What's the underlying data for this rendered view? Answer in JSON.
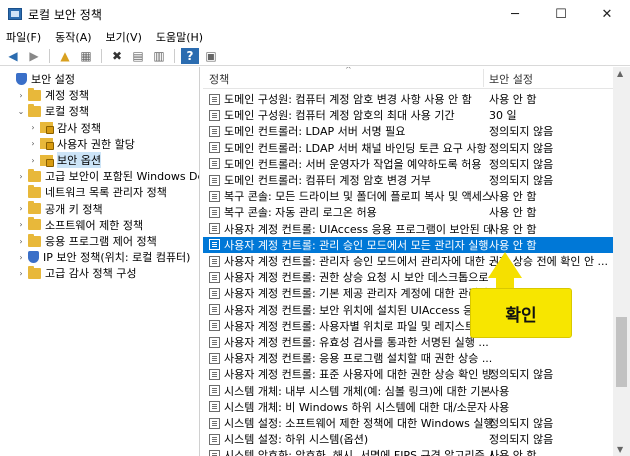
{
  "window": {
    "title": "로컬 보안 정책",
    "minimize": "─",
    "maximize": "☐",
    "close": "✕"
  },
  "menu": [
    "파일(F)",
    "동작(A)",
    "보기(V)",
    "도움말(H)"
  ],
  "toolbar": {
    "back": "◀",
    "forward": "▶",
    "up": "▲",
    "show_hide": "▦",
    "delete": "✖",
    "properties": "▤",
    "export": "▥",
    "help": "?",
    "view": "▣"
  },
  "tree": [
    {
      "label": "보안 설정",
      "level": 0,
      "icon": "shield-icon",
      "expander": ""
    },
    {
      "label": "계정 정책",
      "level": 1,
      "icon": "folder-icon",
      "expander": "›"
    },
    {
      "label": "로컬 정책",
      "level": 1,
      "icon": "folder-icon",
      "expander": "⌄"
    },
    {
      "label": "감사 정책",
      "level": 2,
      "icon": "lock-folder-icon",
      "expander": "›"
    },
    {
      "label": "사용자 권한 할당",
      "level": 2,
      "icon": "lock-folder-icon",
      "expander": "›"
    },
    {
      "label": "보안 옵션",
      "level": 2,
      "icon": "lock-folder-icon",
      "expander": "›",
      "selected": true
    },
    {
      "label": "고급 보안이 포함된 Windows Defende",
      "level": 1,
      "icon": "folder-icon",
      "expander": "›"
    },
    {
      "label": "네트워크 목록 관리자 정책",
      "level": 1,
      "icon": "folder-icon",
      "expander": ""
    },
    {
      "label": "공개 키 정책",
      "level": 1,
      "icon": "folder-icon",
      "expander": "›"
    },
    {
      "label": "소프트웨어 제한 정책",
      "level": 1,
      "icon": "folder-icon",
      "expander": "›"
    },
    {
      "label": "응용 프로그램 제어 정책",
      "level": 1,
      "icon": "folder-icon",
      "expander": "›"
    },
    {
      "label": "IP 보안 정책(위치: 로컬 컴퓨터)",
      "level": 1,
      "icon": "shield-icon",
      "expander": "›"
    },
    {
      "label": "고급 감사 정책 구성",
      "level": 1,
      "icon": "folder-icon",
      "expander": "›"
    }
  ],
  "columns": {
    "policy": "정책",
    "setting": "보안 설정",
    "sort_indicator": "^"
  },
  "rows": [
    {
      "policy": "도메인 구성원: 컴퓨터 계정 암호 변경 사항 사용 안 함",
      "setting": "사용 안 함"
    },
    {
      "policy": "도메인 구성원: 컴퓨터 계정 암호의 최대 사용 기간",
      "setting": "30 일"
    },
    {
      "policy": "도메인 컨트롤러: LDAP 서버 서명 필요",
      "setting": "정의되지 않음"
    },
    {
      "policy": "도메인 컨트롤러: LDAP 서버 채널 바인딩 토큰 요구 사항",
      "setting": "정의되지 않음"
    },
    {
      "policy": "도메인 컨트롤러: 서버 운영자가 작업을 예약하도록 허용",
      "setting": "정의되지 않음"
    },
    {
      "policy": "도메인 컨트롤러: 컴퓨터 계정 암호 변경 거부",
      "setting": "정의되지 않음"
    },
    {
      "policy": "복구 콘솔: 모든 드라이브 및 폴더에 플로피 복사 및 액세스 ...",
      "setting": "사용 안 함"
    },
    {
      "policy": "복구 콘솔: 자동 관리 로그온 허용",
      "setting": "사용 안 함"
    },
    {
      "policy": "사용자 계정 컨트롤: UIAccess 응용 프로그램이 보안된 데스...",
      "setting": "사용 안 함"
    },
    {
      "policy": "사용자 계정 컨트롤: 관리 승인 모드에서 모든 관리자 실행",
      "setting": "사용 안 함",
      "selected": true
    },
    {
      "policy": "사용자 계정 컨트롤: 관리자 승인 모드에서 관리자에 대한 ...",
      "setting": "권한 상승 전에 확인 안 ..."
    },
    {
      "policy": "사용자 계정 컨트롤: 권한 상승 요청 시 보안 데스크톱으로 ...",
      "setting": ""
    },
    {
      "policy": "사용자 계정 컨트롤: 기본 제공 관리자 계정에 대한 관리자 ...",
      "setting": ""
    },
    {
      "policy": "사용자 계정 컨트롤: 보안 위치에 설치된 UIAccess 응용 ...",
      "setting": ""
    },
    {
      "policy": "사용자 계정 컨트롤: 사용자별 위치로 파일 및 레지스트리 ...",
      "setting": ""
    },
    {
      "policy": "사용자 계정 컨트롤: 유효성 검사를 통과한 서명된 실행 ...",
      "setting": ""
    },
    {
      "policy": "사용자 계정 컨트롤: 응용 프로그램 설치할 때 권한 상승 ...",
      "setting": ""
    },
    {
      "policy": "사용자 계정 컨트롤: 표준 사용자에 대한 권한 상승 확인 방법",
      "setting": "정의되지 않음"
    },
    {
      "policy": "시스템 개체: 내부 시스템 개체(예: 심볼 링크)에 대한 기본 ...",
      "setting": "사용"
    },
    {
      "policy": "시스템 개체: 비 Windows 하위 시스템에 대한 대/소문자 구 ...",
      "setting": "사용"
    },
    {
      "policy": "시스템 설정: 소프트웨어 제한 정책에 대한 Windows 실행 ...",
      "setting": "정의되지 않음"
    },
    {
      "policy": "시스템 설정: 하위 시스템(옵션)",
      "setting": "정의되지 않음"
    },
    {
      "policy": "시스템 암호화: 암호화, 해시, 서명에 FIPS 규격 알고리즘 사용",
      "setting": "사용 안 함"
    }
  ],
  "callout": {
    "label": "확인"
  },
  "scroll": {
    "up": "▲",
    "down": "▼"
  }
}
